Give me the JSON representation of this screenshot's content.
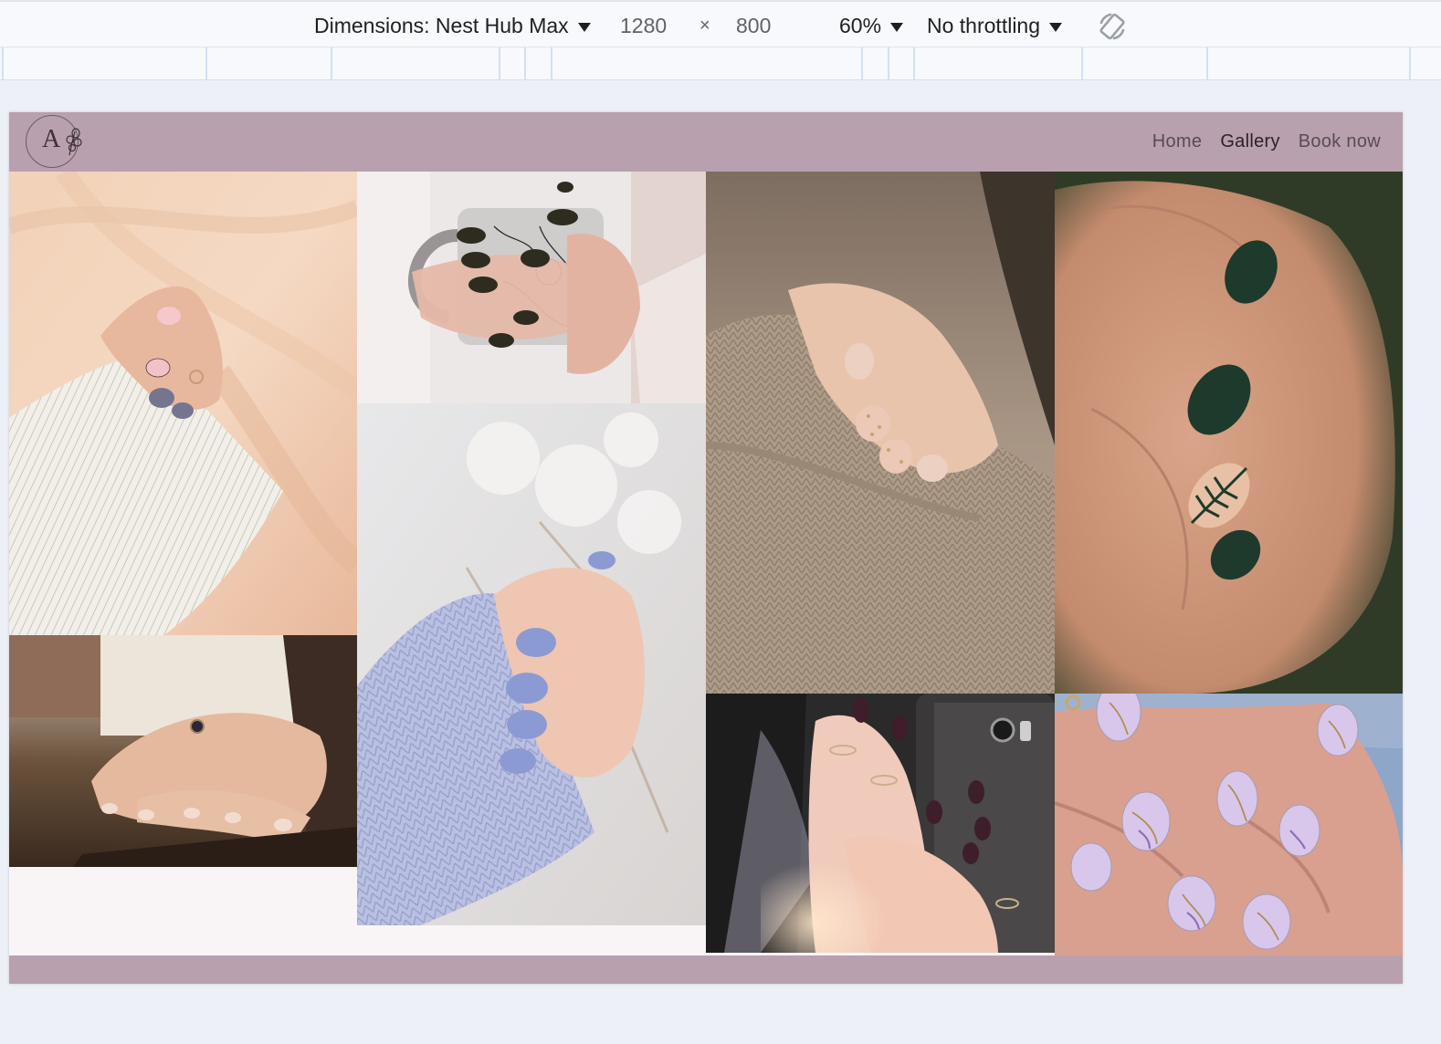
{
  "devtools": {
    "dimensions_label": "Dimensions: Nest Hub Max",
    "width": "1280",
    "times": "×",
    "height": "800",
    "zoom": "60%",
    "throttling": "No throttling",
    "rotate_icon": "rotate-icon"
  },
  "site": {
    "logo_letter": "A",
    "nav": [
      "Home",
      "Gallery",
      "Book now"
    ],
    "active_nav": "Gallery",
    "header_color": "#b8a0af"
  },
  "gallery": {
    "images": [
      "pink nails on peach satin with striped sleeve",
      "dark olive nails holding floral mug",
      "beige polka dot nails on knit sweater",
      "dark green nails with leaf art",
      "nude french nails with ring on wood",
      "periwinkle nails with blue knit sleeve",
      "burgundy nails holding phone with rings",
      "lilac marble nails with gold veins"
    ]
  }
}
